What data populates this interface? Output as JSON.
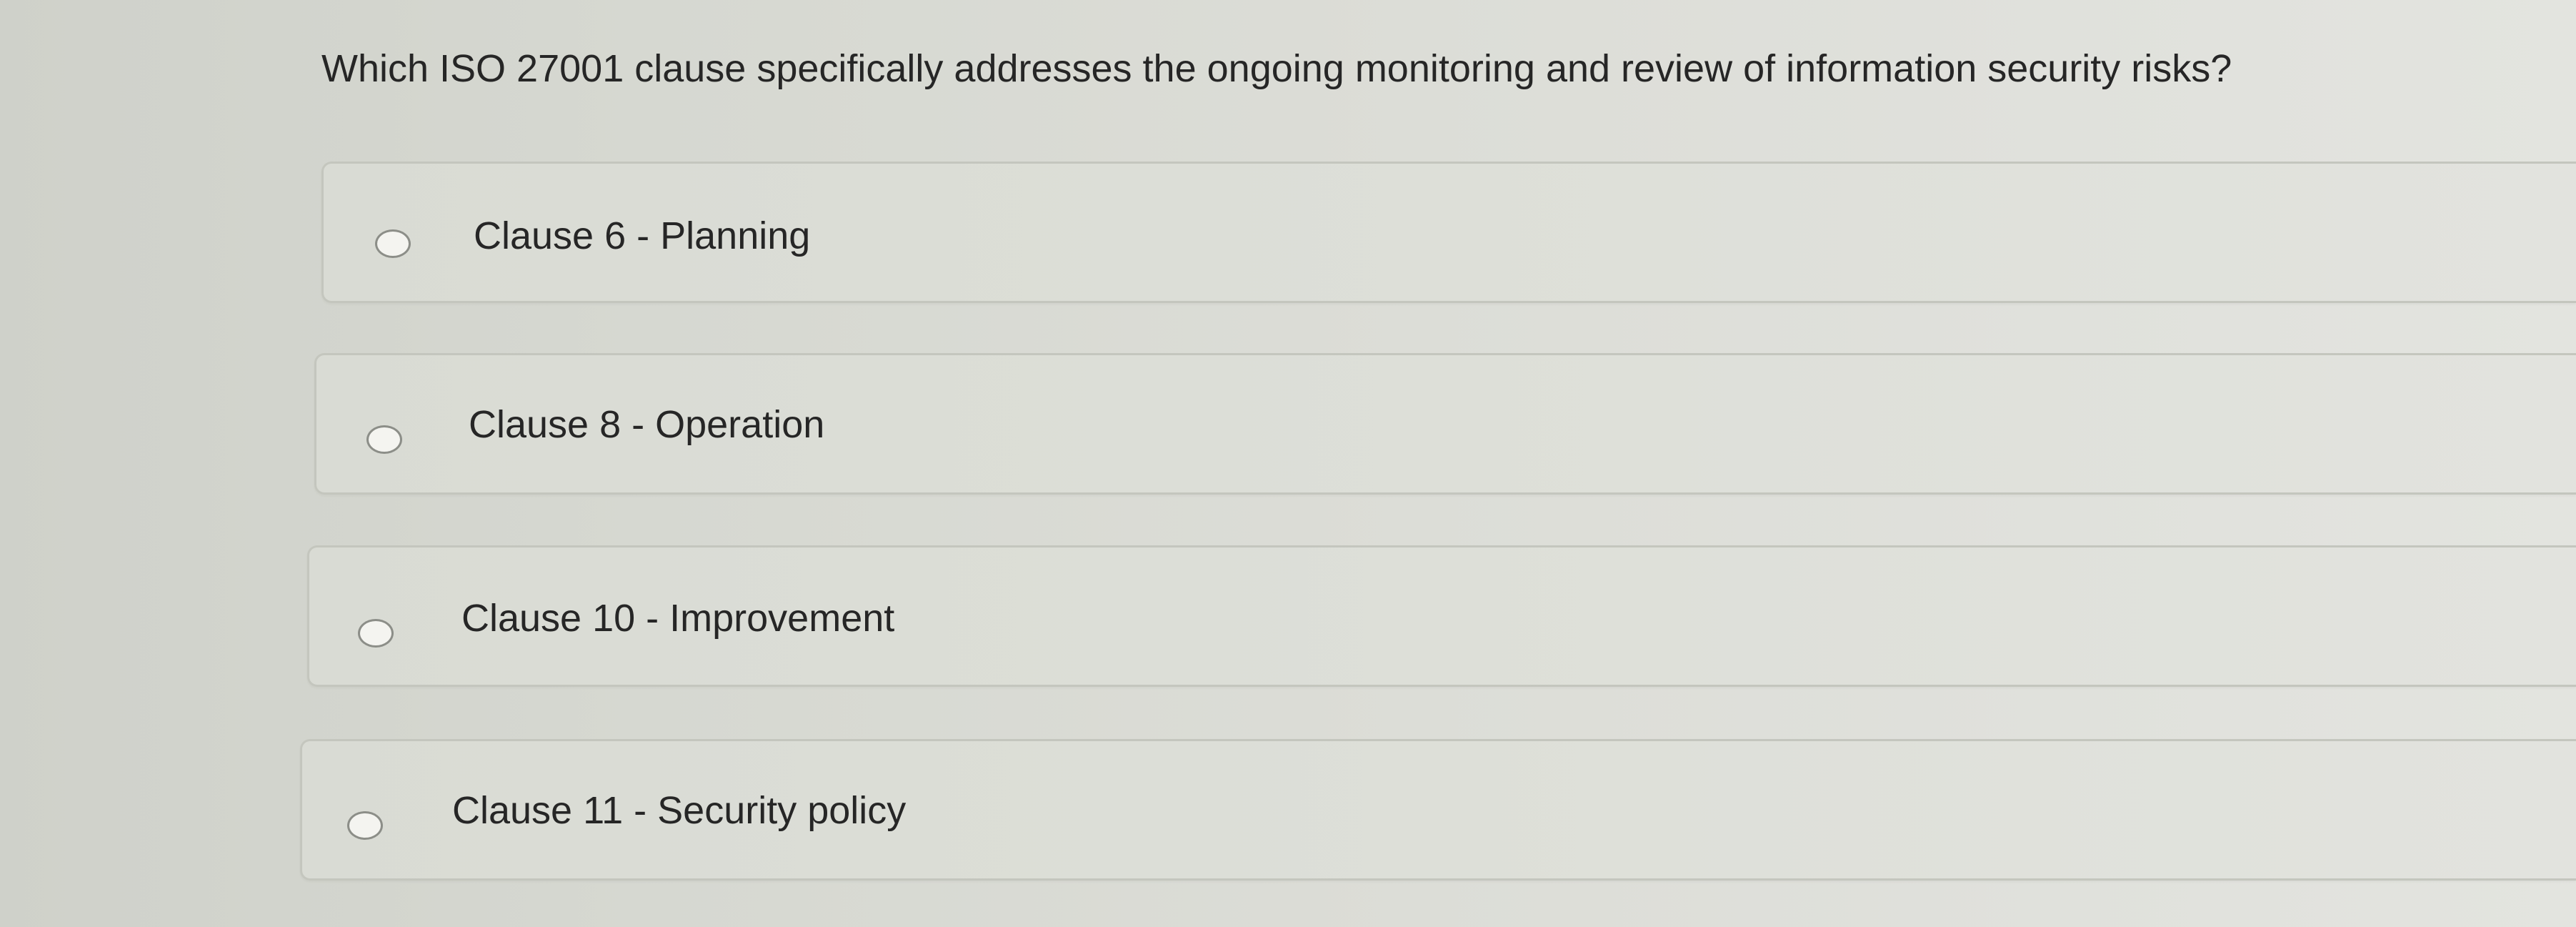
{
  "question": {
    "text": "Which ISO 27001 clause specifically addresses the ongoing monitoring and review of information security risks?"
  },
  "options": [
    {
      "label": "Clause 6 - Planning",
      "selected": false
    },
    {
      "label": "Clause 8 - Operation",
      "selected": false
    },
    {
      "label": "Clause 10 - Improvement",
      "selected": false
    },
    {
      "label": "Clause 11 - Security policy",
      "selected": false
    }
  ],
  "colors": {
    "text": "#262626",
    "radio_border": "#8c8e88",
    "option_border": "#c4c6be"
  }
}
